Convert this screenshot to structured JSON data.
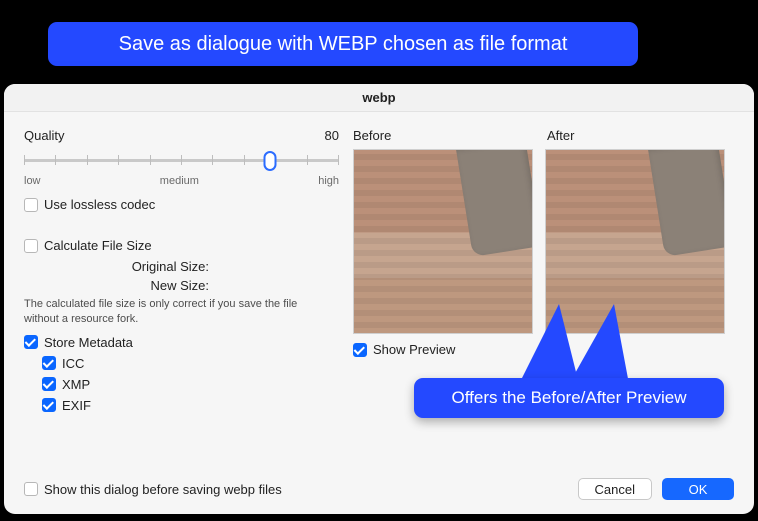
{
  "annotation": {
    "top": "Save as dialogue with WEBP chosen as file format",
    "bubble": "Offers the Before/After Preview"
  },
  "dialog": {
    "title": "webp",
    "quality": {
      "label": "Quality",
      "value": "80",
      "low": "low",
      "medium": "medium",
      "high": "high"
    },
    "lossless": {
      "label": "Use lossless codec",
      "checked": false
    },
    "calcSize": {
      "label": "Calculate File Size",
      "checked": false,
      "originalLabel": "Original Size:",
      "newLabel": "New Size:",
      "hint": "The calculated file size is only correct if you save the file without a resource fork."
    },
    "metadata": {
      "label": "Store Metadata",
      "checked": true,
      "icc": {
        "label": "ICC",
        "checked": true
      },
      "xmp": {
        "label": "XMP",
        "checked": true
      },
      "exif": {
        "label": "EXIF",
        "checked": true
      }
    },
    "preview": {
      "beforeLabel": "Before",
      "afterLabel": "After",
      "showLabel": "Show Preview",
      "showChecked": true
    },
    "footer": {
      "showAgainLabel": "Show this dialog before saving webp files",
      "showAgainChecked": false,
      "cancel": "Cancel",
      "ok": "OK"
    }
  }
}
